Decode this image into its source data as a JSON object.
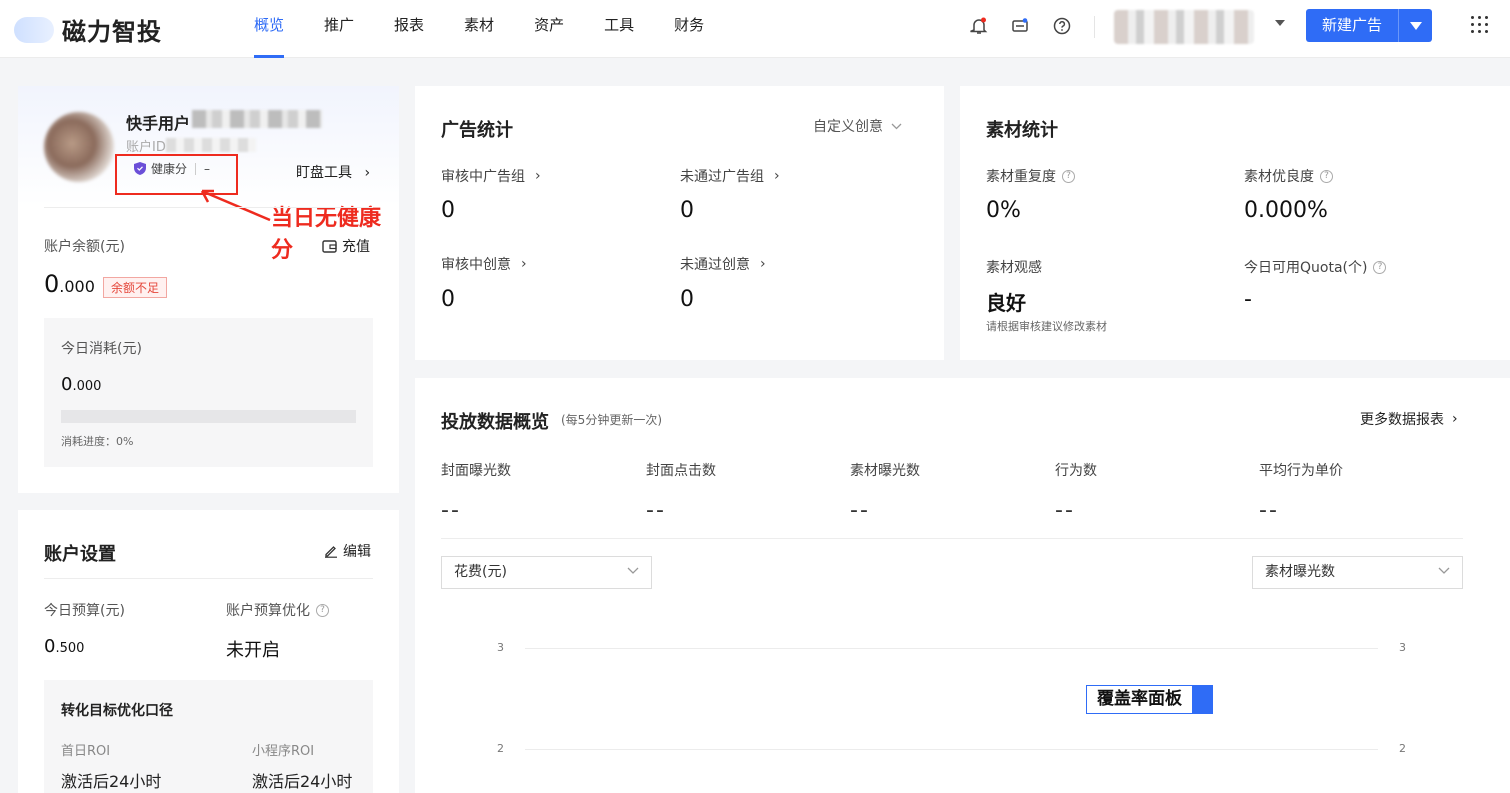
{
  "brand": {
    "name": "磁力智投"
  },
  "nav": {
    "items": [
      {
        "label": "概览",
        "active": true
      },
      {
        "label": "推广",
        "active": false
      },
      {
        "label": "报表",
        "active": false
      },
      {
        "label": "素材",
        "active": false
      },
      {
        "label": "资产",
        "active": false
      },
      {
        "label": "工具",
        "active": false
      },
      {
        "label": "财务",
        "active": false
      }
    ],
    "new_ad_label": "新建广告"
  },
  "account": {
    "name_prefix": "快手用户",
    "id_label": "账户ID",
    "health_label": "健康分",
    "health_value": "–",
    "pan_tool": "盯盘工具",
    "annotation": "当日无健康分",
    "balance_label": "账户余额(元)",
    "recharge": "充值",
    "balance_int": "0",
    "balance_dec": ".000",
    "balance_badge": "余额不足",
    "today_label": "今日消耗(元)",
    "today_int": "0",
    "today_dec": ".000",
    "progress_label": "消耗进度：",
    "progress_value": "0%",
    "progress_fraction": 0
  },
  "settings": {
    "title": "账户设置",
    "edit": "编辑",
    "budget_label": "今日预算(元)",
    "budget_int": "0",
    "budget_dec": ".500",
    "opt_label": "账户预算优化",
    "opt_value": "未开启",
    "conv_title": "转化目标优化口径",
    "conv_l1": "首日ROI",
    "conv_l2": "小程序ROI",
    "conv_v1": "激活后24小时",
    "conv_v2": "激活后24小时"
  },
  "ad_stats": {
    "title": "广告统计",
    "dropdown": "自定义创意",
    "items": [
      {
        "label": "审核中广告组",
        "value": "0"
      },
      {
        "label": "未通过广告组",
        "value": "0"
      },
      {
        "label": "审核中创意",
        "value": "0"
      },
      {
        "label": "未通过创意",
        "value": "0"
      }
    ]
  },
  "material": {
    "title": "素材统计",
    "items": [
      {
        "label": "素材重复度",
        "value": "0%"
      },
      {
        "label": "素材优良度",
        "value": "0.000%"
      },
      {
        "label": "素材观感",
        "value": "良好"
      },
      {
        "label": "今日可用Quota(个)",
        "value": "-"
      }
    ],
    "sub": "请根据审核建议修改素材"
  },
  "overview": {
    "title": "投放数据概览",
    "sub": "(每5分钟更新一次)",
    "more": "更多数据报表",
    "metrics": [
      {
        "label": "封面曝光数",
        "value": "--"
      },
      {
        "label": "封面点击数",
        "value": "--"
      },
      {
        "label": "素材曝光数",
        "value": "--"
      },
      {
        "label": "行为数",
        "value": "--"
      },
      {
        "label": "平均行为单价",
        "value": "--"
      }
    ],
    "left_select": "花费(元)",
    "right_select": "素材曝光数",
    "tooltip": "覆盖率面板"
  },
  "chart_data": {
    "type": "line",
    "y_left_ticks": [
      "3",
      "2"
    ],
    "y_right_ticks": [
      "3",
      "2"
    ]
  },
  "colors": {
    "accent": "#2f6cf6",
    "alert": "#ee2b1f"
  }
}
